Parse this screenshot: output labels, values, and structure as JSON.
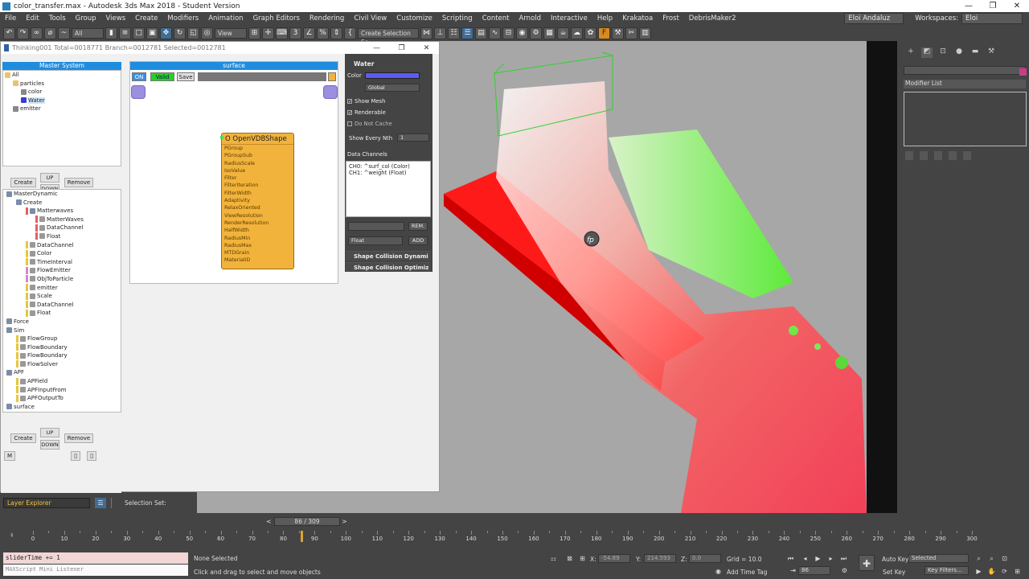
{
  "window": {
    "title": "color_transfer.max - Autodesk 3ds Max 2018 - Student Version",
    "controls": [
      "—",
      "❐",
      "✕"
    ]
  },
  "menu": {
    "items": [
      "File",
      "Edit",
      "Tools",
      "Group",
      "Views",
      "Create",
      "Modifiers",
      "Animation",
      "Graph Editors",
      "Rendering",
      "Civil View",
      "Customize",
      "Scripting",
      "Content",
      "Arnold",
      "Interactive",
      "Help",
      "Krakatoa",
      "Frost",
      "DebrisMaker2"
    ],
    "user": "Eloi Andaluz",
    "workspaces_label": "Workspaces:",
    "workspace": "Eloi"
  },
  "toolbar": {
    "selection_filter": "All",
    "ref_coord": "View",
    "named_selection": "Create Selection Se"
  },
  "thinking": {
    "title": "Thinking001  Total=0018771  Branch=0012781  Selected=0012781",
    "master_header": "Master System",
    "master_tree": [
      {
        "label": "All",
        "depth": 0,
        "icon": "folder-icon",
        "color": "#e8c46a"
      },
      {
        "label": "particles",
        "depth": 1,
        "icon": "folder-icon",
        "color": "#e8c46a"
      },
      {
        "label": "color",
        "depth": 2,
        "icon": "gear-icon",
        "color": "#888888"
      },
      {
        "label": "Water",
        "depth": 2,
        "icon": "bar-icon",
        "color": "#3b3bd0",
        "selected": true
      },
      {
        "label": "emitter",
        "depth": 1,
        "icon": "gear-icon",
        "color": "#888888"
      }
    ],
    "buttons": {
      "create": "Create",
      "up": "UP",
      "down": "DOWN",
      "remove": "Remove",
      "m": "M"
    },
    "dynamic_tree": [
      {
        "label": "MasterDynamic",
        "depth": 0,
        "icon": "folder-icon",
        "bar": ""
      },
      {
        "label": "Create",
        "depth": 1,
        "icon": "folder-icon",
        "bar": ""
      },
      {
        "label": "Matterwaves",
        "depth": 2,
        "icon": "folder-icon",
        "bar": "#e06060"
      },
      {
        "label": "MatterWaves",
        "depth": 3,
        "icon": "grid-icon",
        "bar": "#e06060"
      },
      {
        "label": "DataChannel",
        "depth": 3,
        "icon": "gear-icon",
        "bar": "#e06060"
      },
      {
        "label": "Float",
        "depth": 3,
        "icon": "gear-icon",
        "bar": "#e06060"
      },
      {
        "label": "DataChannel",
        "depth": 2,
        "icon": "gear-icon",
        "bar": "#e6c640"
      },
      {
        "label": "Color",
        "depth": 2,
        "icon": "gear-icon",
        "bar": "#e6c640"
      },
      {
        "label": "TimeInterval",
        "depth": 2,
        "icon": "gear-icon",
        "bar": "#e6c640"
      },
      {
        "label": "FlowEmitter",
        "depth": 2,
        "icon": "gear-icon",
        "bar": "#e080d0"
      },
      {
        "label": "ObjToParticle",
        "depth": 2,
        "icon": "gear-icon",
        "bar": "#e080d0"
      },
      {
        "label": "emitter",
        "depth": 2,
        "icon": "gear-icon",
        "bar": "#e6c640"
      },
      {
        "label": "Scale",
        "depth": 2,
        "icon": "gear-icon",
        "bar": "#e6c640"
      },
      {
        "label": "DataChannel",
        "depth": 2,
        "icon": "gear-icon",
        "bar": "#e6c640"
      },
      {
        "label": "Float",
        "depth": 2,
        "icon": "gear-icon",
        "bar": "#e6c640"
      },
      {
        "label": "Force",
        "depth": 0,
        "icon": "folder-icon",
        "bar": ""
      },
      {
        "label": "Sim",
        "depth": 0,
        "icon": "folder-icon",
        "bar": ""
      },
      {
        "label": "FlowGroup",
        "depth": 1,
        "icon": "gear-icon",
        "bar": "#e6c640"
      },
      {
        "label": "FlowBoundary",
        "depth": 1,
        "icon": "gear-icon",
        "bar": "#e6c640"
      },
      {
        "label": "FlowBoundary",
        "depth": 1,
        "icon": "gear-icon",
        "bar": "#e6c640"
      },
      {
        "label": "FlowSolver",
        "depth": 1,
        "icon": "gear-icon",
        "bar": "#e6c640"
      },
      {
        "label": "APF",
        "depth": 0,
        "icon": "folder-icon",
        "bar": ""
      },
      {
        "label": "APField",
        "depth": 1,
        "icon": "gear-icon",
        "bar": "#e6c640"
      },
      {
        "label": "APFInputFrom",
        "depth": 1,
        "icon": "gear-icon",
        "bar": "#e6c640"
      },
      {
        "label": "APFOutputTo",
        "depth": 1,
        "icon": "gear-icon",
        "bar": "#e6c640"
      },
      {
        "label": "surface",
        "depth": 0,
        "icon": "folder-icon",
        "bar": ""
      }
    ],
    "graph_header": "surface",
    "graph_chips": {
      "on": "ON",
      "valid": "Valid",
      "save": "Save"
    },
    "node": {
      "title": "O OpenVDBShape",
      "rows": [
        "PGroup",
        "PGroupSub",
        "RadiusScale",
        "IsoValue",
        "Filter",
        "FilterIteration",
        "FilterWidth",
        "Adaptivity",
        "RelaxOriented",
        "ViewResolution",
        "RenderResolution",
        "HalfWidth",
        "RadiusMin",
        "RadiusMax",
        "MTDGrain",
        "MaterialID"
      ]
    },
    "props": {
      "section": "Water",
      "color_label": "Color",
      "color_value": "#5c5cf0",
      "space": "Global",
      "show_mesh": "Show Mesh",
      "renderable": "Renderable",
      "do_not_cache": "Do Not Cache",
      "show_every_nth": "Show Every Nth",
      "nth_value": "1",
      "data_channels": "Data Channels",
      "channels": [
        "CH0: ^surf_col (Color)",
        "CH1: ^weight (Float)"
      ],
      "rem": "REM.",
      "type": "Float",
      "add": "ADD",
      "rollouts": [
        "Shape Collision Dynami",
        "Shape Collision Optimiz"
      ]
    }
  },
  "command_panel": {
    "modifier_list": "Modifier List"
  },
  "layer": {
    "explorer": "Layer Explorer",
    "selection_set": "Selection Set:"
  },
  "timeslider": {
    "label": "86 / 309",
    "ticks": [
      0,
      10,
      20,
      30,
      40,
      50,
      60,
      70,
      80,
      90,
      100,
      110,
      120,
      130,
      140,
      150,
      160,
      170,
      180,
      190,
      200,
      210,
      220,
      230,
      240,
      250,
      260,
      270,
      280,
      290,
      300
    ]
  },
  "status": {
    "maxscript_line1": "sliderTime += 1",
    "maxscript_line2": "MAXScript Mini Listener",
    "selected": "None Selected",
    "prompt": "Click and drag to select and move objects",
    "x_label": "X:",
    "x_value": "-54.89",
    "y_label": "Y:",
    "y_value": "214.593",
    "z_label": "Z:",
    "z_value": "0.0",
    "grid": "Grid = 10.0",
    "add_time_tag": "Add Time Tag",
    "frame": "86",
    "auto_key": "Auto Key",
    "set_key": "Set Key",
    "key_mode": "Selected",
    "key_filters": "Key Filters..."
  },
  "viewport": {
    "badge": "fp"
  }
}
